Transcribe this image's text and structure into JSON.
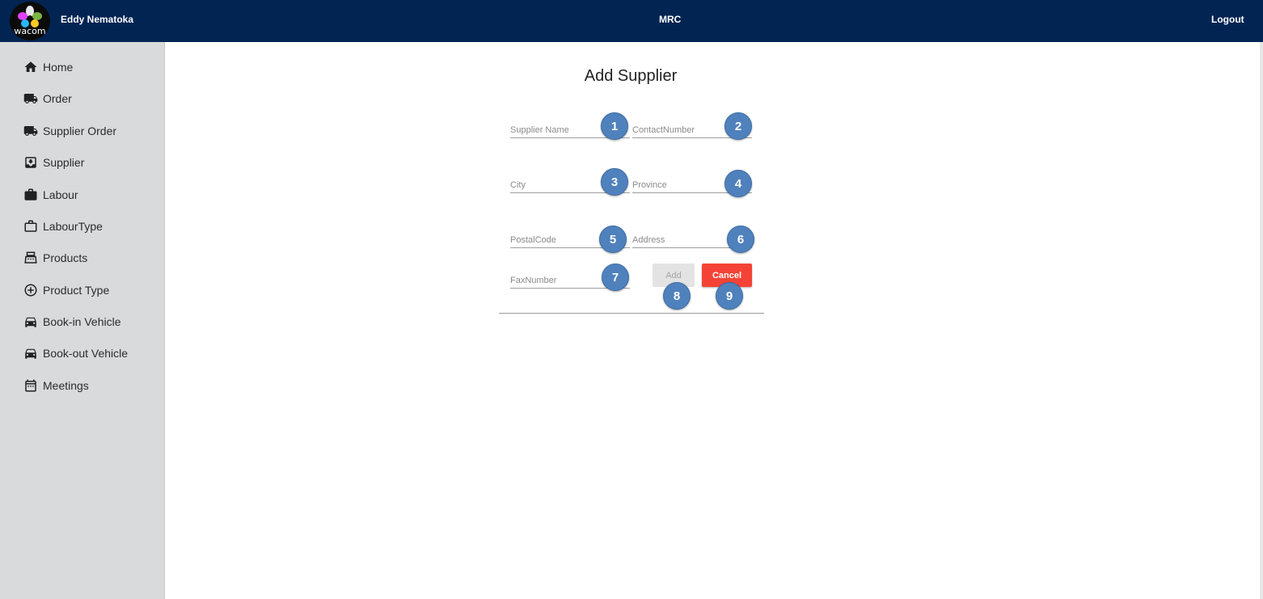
{
  "header": {
    "user_name": "Eddy Nematoka",
    "app_title": "MRC",
    "logout_label": "Logout",
    "logo_text": "wacom",
    "bg_color": "#012453"
  },
  "sidebar": {
    "items": [
      {
        "label": "Home",
        "icon": "home-icon"
      },
      {
        "label": "Order",
        "icon": "truck-icon"
      },
      {
        "label": "Supplier Order",
        "icon": "truck-icon"
      },
      {
        "label": "Supplier",
        "icon": "inbox-icon"
      },
      {
        "label": "Labour",
        "icon": "briefcase-icon"
      },
      {
        "label": "LabourType",
        "icon": "briefcase-outline-icon"
      },
      {
        "label": "Products",
        "icon": "register-icon"
      },
      {
        "label": "Product Type",
        "icon": "add-circle-icon"
      },
      {
        "label": "Book-in Vehicle",
        "icon": "car-icon"
      },
      {
        "label": "Book-out Vehicle",
        "icon": "car-icon"
      },
      {
        "label": "Meetings",
        "icon": "calendar-icon"
      }
    ]
  },
  "form": {
    "title": "Add Supplier",
    "fields": {
      "supplier_name": {
        "placeholder": "Supplier Name",
        "value": ""
      },
      "contact_number": {
        "placeholder": "ContactNumber",
        "value": ""
      },
      "city": {
        "placeholder": "City",
        "value": ""
      },
      "province": {
        "placeholder": "Province",
        "value": ""
      },
      "postal_code": {
        "placeholder": "PostalCode",
        "value": ""
      },
      "address": {
        "placeholder": "Address",
        "value": ""
      },
      "fax_number": {
        "placeholder": "FaxNumber",
        "value": ""
      }
    },
    "add_label": "Add",
    "cancel_label": "Cancel",
    "cancel_color": "#f44336"
  },
  "annotations": {
    "badges": [
      "1",
      "2",
      "3",
      "4",
      "5",
      "6",
      "7",
      "8",
      "9"
    ],
    "color": "#4f81bd"
  }
}
